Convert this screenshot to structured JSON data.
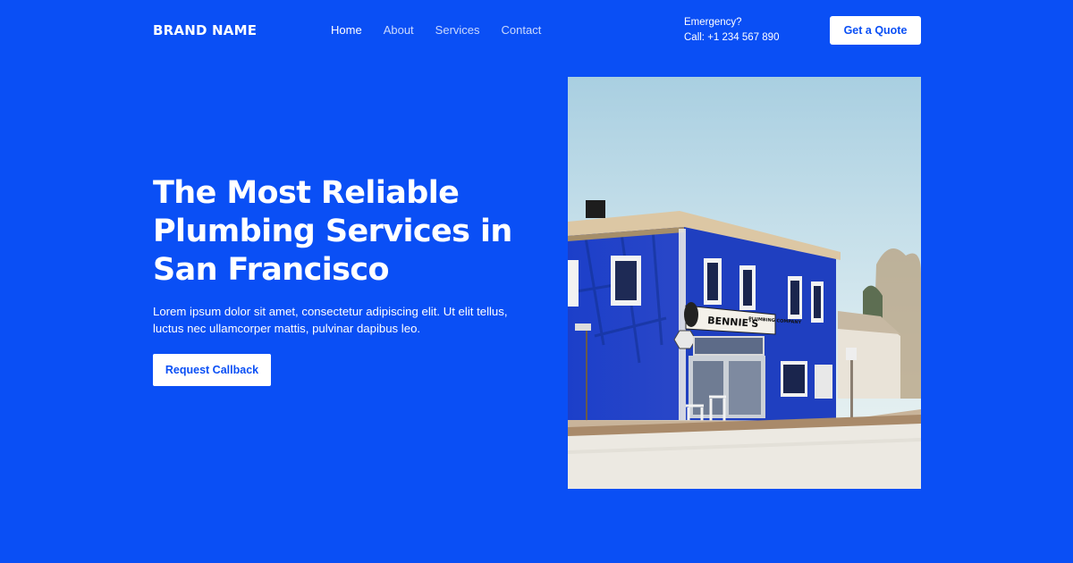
{
  "header": {
    "brand": "BRAND NAME",
    "nav": [
      {
        "label": "Home",
        "active": true
      },
      {
        "label": "About",
        "active": false
      },
      {
        "label": "Services",
        "active": false
      },
      {
        "label": "Contact",
        "active": false
      }
    ],
    "emergency": {
      "label": "Emergency?",
      "phone": "Call: +1 234 567 890"
    },
    "cta_label": "Get a Quote"
  },
  "hero": {
    "title_lines": [
      "The Most Reliable",
      "Plumbing Services in",
      "San Francisco"
    ],
    "description": "Lorem ipsum dolor sit amet, consectetur adipiscing elit. Ut elit tellus, luctus nec ullamcorper mattis, pulvinar dapibus leo.",
    "button_label": "Request Callback",
    "image": {
      "sign_line1": "BENNIE'S",
      "sign_line2": "PLUMBING COMPANY"
    }
  },
  "colors": {
    "background": "#0a4ff5",
    "text": "#ffffff",
    "button_bg": "#ffffff",
    "button_text": "#0a4ff5"
  }
}
